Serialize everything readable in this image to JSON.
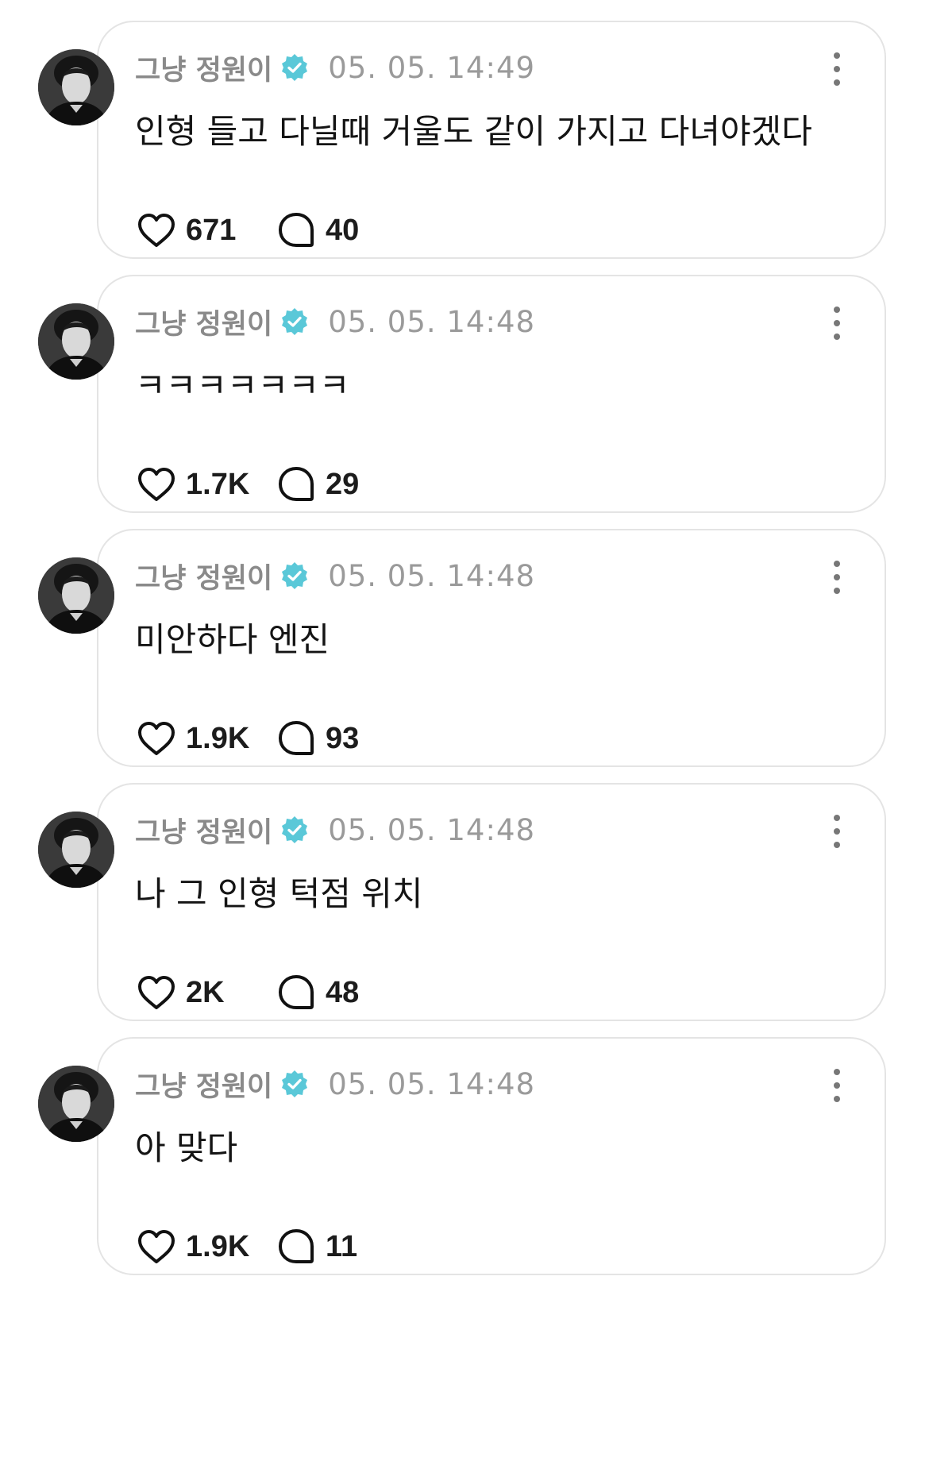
{
  "colors": {
    "verified_badge": "#5ac8d8",
    "username": "#8a8a8a",
    "timestamp": "#9a9a9a",
    "card_border": "#e4e4e4"
  },
  "icons": {
    "like": "heart-icon",
    "reply": "speech-bubble-icon",
    "verified": "verified-badge-icon",
    "more": "vertical-ellipsis-icon"
  },
  "posts": [
    {
      "author": "그냥 정원이",
      "timestamp": "05. 05. 14:49",
      "text": "인형 들고 다닐때 거울도 같이 가지고 다녀야겠다",
      "likes": "671",
      "replies": "40"
    },
    {
      "author": "그냥 정원이",
      "timestamp": "05. 05. 14:48",
      "text": "ㅋㅋㅋㅋㅋㅋㅋ",
      "likes": "1.7K",
      "replies": "29"
    },
    {
      "author": "그냥 정원이",
      "timestamp": "05. 05. 14:48",
      "text": "미안하다 엔진",
      "likes": "1.9K",
      "replies": "93"
    },
    {
      "author": "그냥 정원이",
      "timestamp": "05. 05. 14:48",
      "text": "나 그 인형 턱점 위치",
      "likes": "2K",
      "replies": "48"
    },
    {
      "author": "그냥 정원이",
      "timestamp": "05. 05. 14:48",
      "text": "아 맞다",
      "likes": "1.9K",
      "replies": "11"
    }
  ]
}
